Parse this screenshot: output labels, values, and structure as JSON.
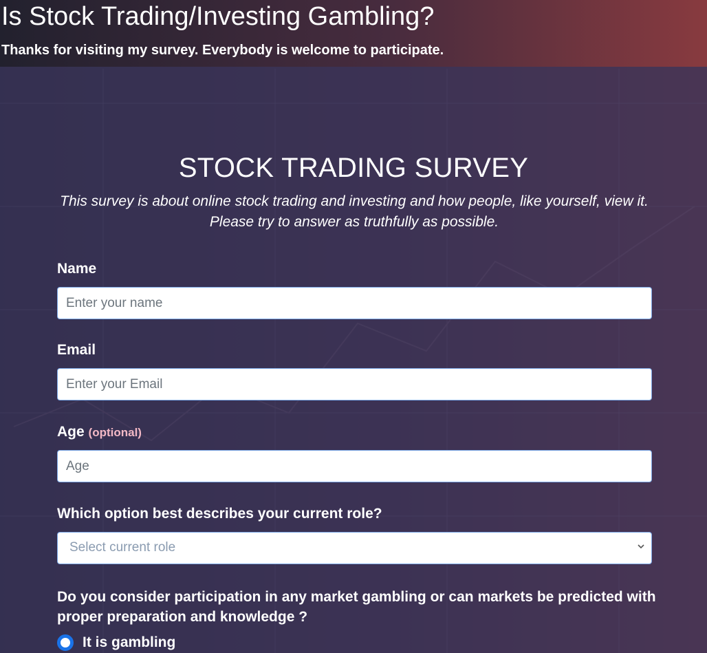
{
  "header": {
    "title": "Is Stock Trading/Investing Gambling?",
    "subtitle": "Thanks for visiting my survey. Everybody is welcome to participate."
  },
  "survey": {
    "title": "STOCK TRADING SURVEY",
    "description": "This survey is about online stock trading and investing and how people, like yourself, view it. Please try to answer as truthfully as possible."
  },
  "fields": {
    "name": {
      "label": "Name",
      "placeholder": "Enter your name"
    },
    "email": {
      "label": "Email",
      "placeholder": "Enter your Email"
    },
    "age": {
      "label": "Age",
      "optional": "(optional)",
      "placeholder": "Age"
    },
    "role": {
      "label": "Which option best describes your current role?",
      "selected": "Select current role"
    }
  },
  "question": {
    "label": "Do you consider participation in any market gambling or can markets be predicted with proper preparation and knowledge ?",
    "options": [
      {
        "label": "It is gambling",
        "checked": true
      }
    ]
  },
  "colors": {
    "accent": "#1a73e8",
    "panel": "#3a345a",
    "optional": "#f3b9c6"
  },
  "icons": {
    "select_caret": "chevron-down-icon",
    "radio": "radio-selected-icon"
  }
}
